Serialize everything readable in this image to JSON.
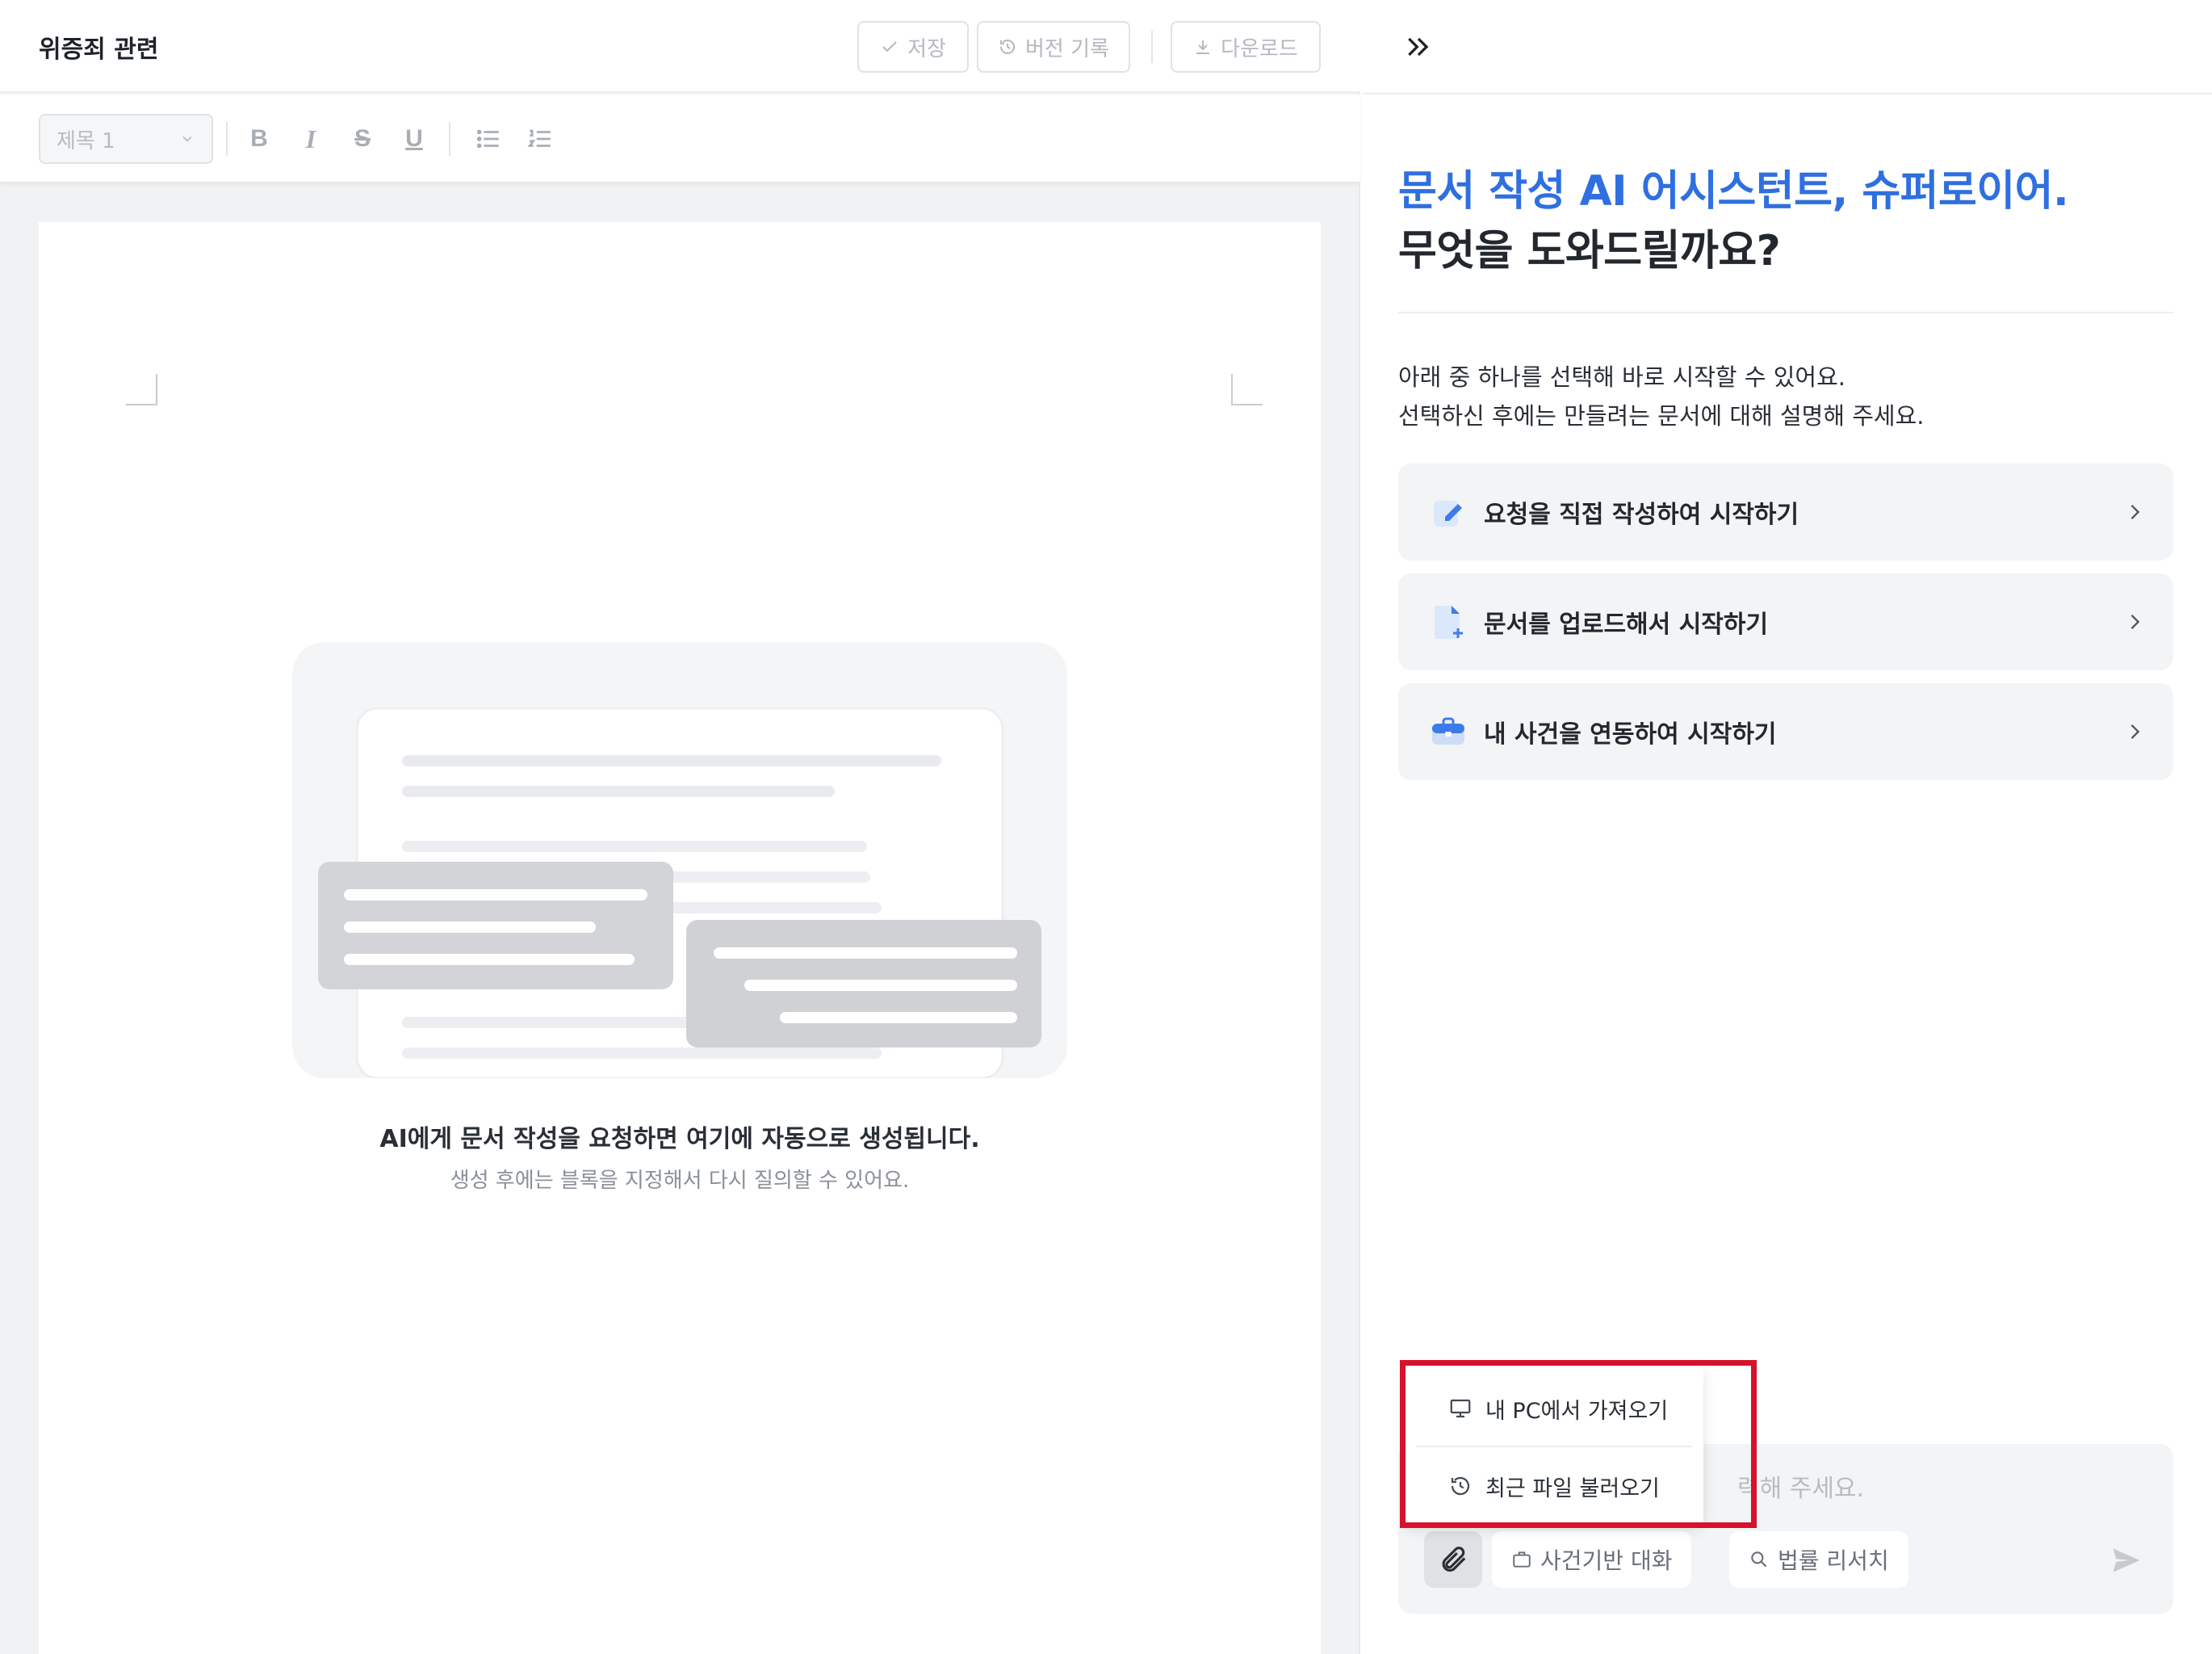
{
  "editor": {
    "doc_title": "위증죄 관련",
    "header_buttons": {
      "save": "저장",
      "history": "버전 기록",
      "download": "다운로드"
    },
    "toolbar": {
      "style_select": "제목 1",
      "bold": "B",
      "italic": "I",
      "strike": "S",
      "underline": "U"
    },
    "empty_state": {
      "title": "AI에게 문서 작성을 요청하면 여기에 자동으로 생성됩니다.",
      "subtitle": "생성 후에는 블록을 지정해서 다시 질의할 수 있어요."
    }
  },
  "assistant": {
    "hero_line1": "문서 작성 AI 어시스턴트, 슈퍼로이어.",
    "hero_line2": "무엇을 도와드릴까요?",
    "intro_line1": "아래 중 하나를 선택해 바로 시작할 수 있어요.",
    "intro_line2": "선택하신 후에는 만들려는 문서에 대해 설명해 주세요.",
    "options": [
      {
        "label": "요청을 직접 작성하여 시작하기",
        "icon": "pencil-note-icon"
      },
      {
        "label": "문서를 업로드해서 시작하기",
        "icon": "file-add-icon"
      },
      {
        "label": "내 사건을 연동하여 시작하기",
        "icon": "briefcase-icon"
      }
    ],
    "input": {
      "placeholder_visible": "력해 주세요."
    },
    "chips": {
      "case_chat": "사건기반 대화",
      "legal_research": "법률 리서치"
    },
    "attach_menu": {
      "from_pc": "내 PC에서 가져오기",
      "recent_files": "최근 파일 불러오기"
    }
  },
  "colors": {
    "accent_blue": "#2f6fe0",
    "highlight_red": "#d6122c",
    "option_bg": "#f3f4f6"
  }
}
